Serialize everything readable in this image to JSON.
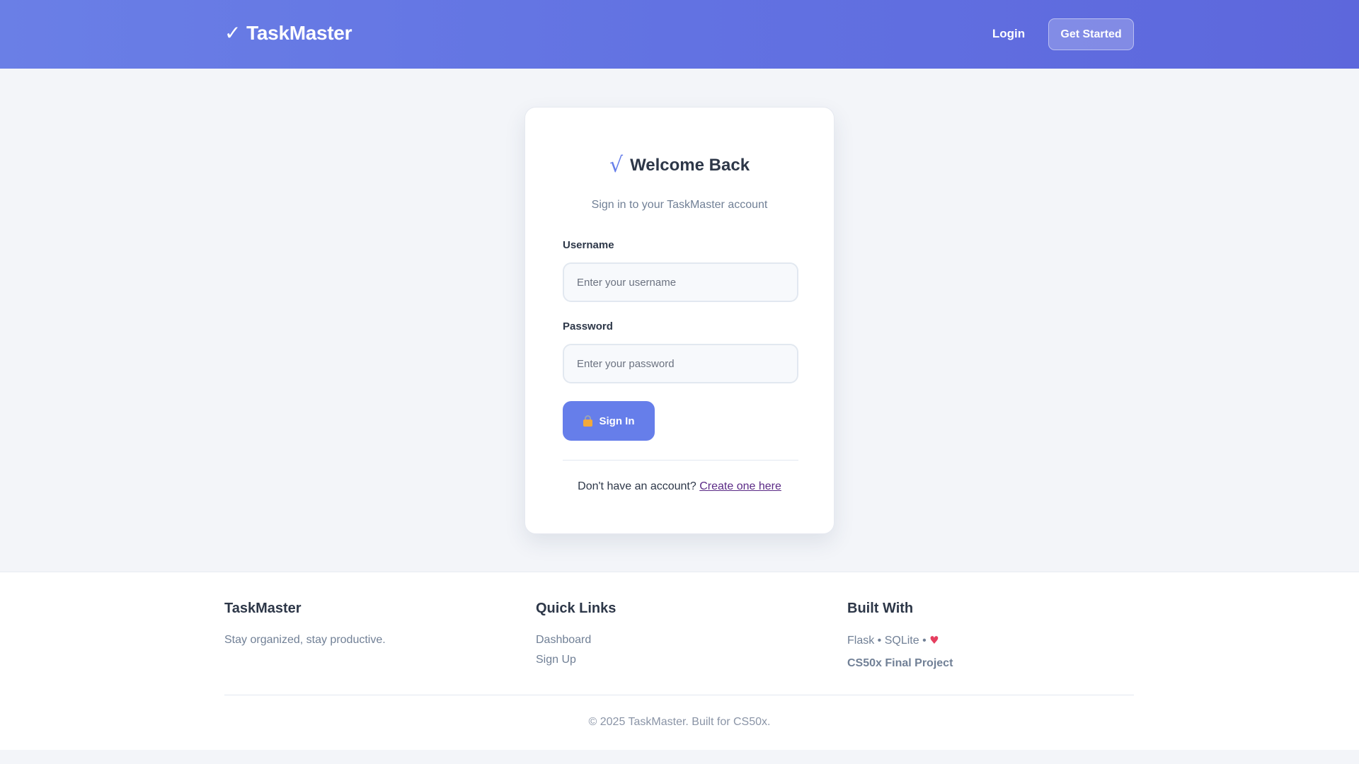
{
  "header": {
    "brand_icon": "checkmark-icon",
    "brand_text": "TaskMaster",
    "nav_login": "Login",
    "nav_get_started": "Get Started"
  },
  "login_card": {
    "title_icon": "checkmark-icon",
    "title": "Welcome Back",
    "subtitle": "Sign in to your TaskMaster account",
    "username_label": "Username",
    "username_placeholder": "Enter your username",
    "username_value": "",
    "password_label": "Password",
    "password_placeholder": "Enter your password",
    "password_value": "",
    "signin_icon": "lock-icon",
    "signin_label": "Sign In",
    "no_account_text": "Don't have an account?",
    "create_link": "Create one here"
  },
  "footer": {
    "col1": {
      "heading": "TaskMaster",
      "tagline": "Stay organized, stay productive."
    },
    "col2": {
      "heading": "Quick Links",
      "links": [
        "Dashboard",
        "Sign Up"
      ]
    },
    "col3": {
      "heading": "Built With",
      "tech": "Flask • SQLite •",
      "heart_icon": "heart-icon",
      "project": "CS50x Final Project"
    },
    "copyright": "© 2025 TaskMaster. Built for CS50x."
  },
  "colors": {
    "accent": "#667eea",
    "header_gradient_start": "#6a7fe6",
    "header_gradient_end": "#5d67dc",
    "link_visited": "#5b2a86",
    "heart": "#e53e5f"
  }
}
